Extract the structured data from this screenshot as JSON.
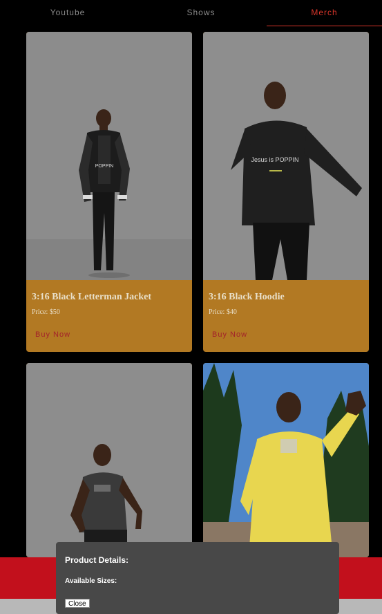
{
  "nav": {
    "tabs": [
      {
        "label": "Youtube"
      },
      {
        "label": "Shows"
      },
      {
        "label": "Merch"
      }
    ],
    "active_tab": "Merch"
  },
  "products": [
    {
      "title": "3:16 Black Letterman Jacket",
      "price": "Price: $50",
      "button": "Buy Now",
      "shirt_text": "POPPIN"
    },
    {
      "title": "3:16 Black Hoodie",
      "price": "Price: $40",
      "button": "Buy Now",
      "shirt_text": "Jesus is POPPIN"
    },
    {
      "title": "",
      "price": "",
      "button": ""
    },
    {
      "title": "",
      "price": "",
      "button": ""
    }
  ],
  "modal": {
    "title": "Product Details:",
    "sizes_label": "Available Sizes:",
    "close_label": "Close"
  },
  "colors": {
    "background": "#000000",
    "accent": "#d8352a",
    "card": "#b27923",
    "footer_red": "#c2101c",
    "modal": "#484848"
  }
}
